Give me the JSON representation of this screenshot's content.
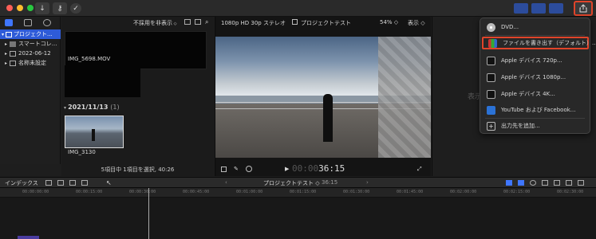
{
  "toolbar": {
    "import_icon": "↓",
    "key_icon": "⚷",
    "check_icon": "✓"
  },
  "library": {
    "items": [
      {
        "label": "プロジェクト..."
      },
      {
        "label": "スマートコレ..."
      },
      {
        "label": "2022-06-12"
      },
      {
        "label": "名称未設定"
      }
    ]
  },
  "browser": {
    "filter": "不採用を非表示",
    "clips": [
      {
        "name": "IMG_5698.MOV"
      },
      {
        "name": "IMG_3130"
      }
    ],
    "group_date": "2021/11/13",
    "group_count": "(1)",
    "status": "5項目中 1項目を選択, 40:26"
  },
  "viewer": {
    "format": "1080p HD 30p ステレオ",
    "project": "プロジェクトテスト",
    "zoom": "54%",
    "view_label": "表示",
    "timecode_dim": "00:00",
    "timecode": "36:15"
  },
  "inspector": {
    "placeholder": "表示"
  },
  "share_menu": {
    "items": [
      {
        "label": "DVD..."
      },
      {
        "label": "ファイルを書き出す（デフォルト）..."
      },
      {
        "label": "Apple デバイス 720p..."
      },
      {
        "label": "Apple デバイス 1080p..."
      },
      {
        "label": "Apple デバイス 4K..."
      },
      {
        "label": "YouTube および Facebook..."
      },
      {
        "label": "出力先を追加..."
      }
    ]
  },
  "timeline": {
    "index_label": "インデックス",
    "project": "プロジェクトテスト",
    "duration": "36:15",
    "ruler": [
      "00:00:00:00",
      "00:00:15:00",
      "00:00:30:00",
      "00:00:45:00",
      "00:01:00:00",
      "00:01:15:00",
      "00:01:30:00",
      "00:01:45:00",
      "00:02:00:00",
      "00:02:15:00",
      "00:02:30:00"
    ]
  },
  "colors": {
    "accent": "#2e5bd8",
    "highlight_border": "#e0442a"
  }
}
